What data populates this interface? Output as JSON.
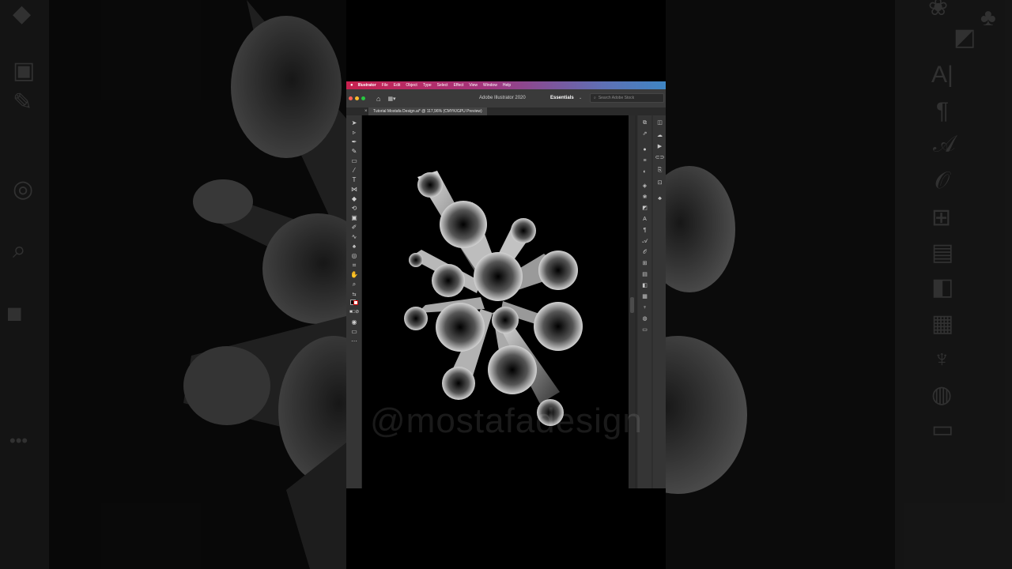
{
  "menubar": {
    "apple_icon": "apple-icon",
    "items": [
      "Illustrator",
      "File",
      "Edit",
      "Object",
      "Type",
      "Select",
      "Effect",
      "View",
      "Window",
      "Help"
    ]
  },
  "appbar": {
    "title": "Adobe Illustrator 2020",
    "workspace": "Essentials",
    "search_placeholder": "Search Adobe Stock"
  },
  "document": {
    "tab_label": "Tutorial Mostafa Design.ai* @ 117,96% (CMYK/GPU Preview)",
    "close_glyph": "×"
  },
  "watermark": "@mostafadesign",
  "colors": {
    "menubar_start": "#c8214f",
    "menubar_end": "#3f86c4",
    "app_bg": "#323232",
    "artboard": "#000000",
    "dot_red": "#ff5f57",
    "dot_yellow": "#febc2e",
    "dot_green": "#28c840"
  }
}
